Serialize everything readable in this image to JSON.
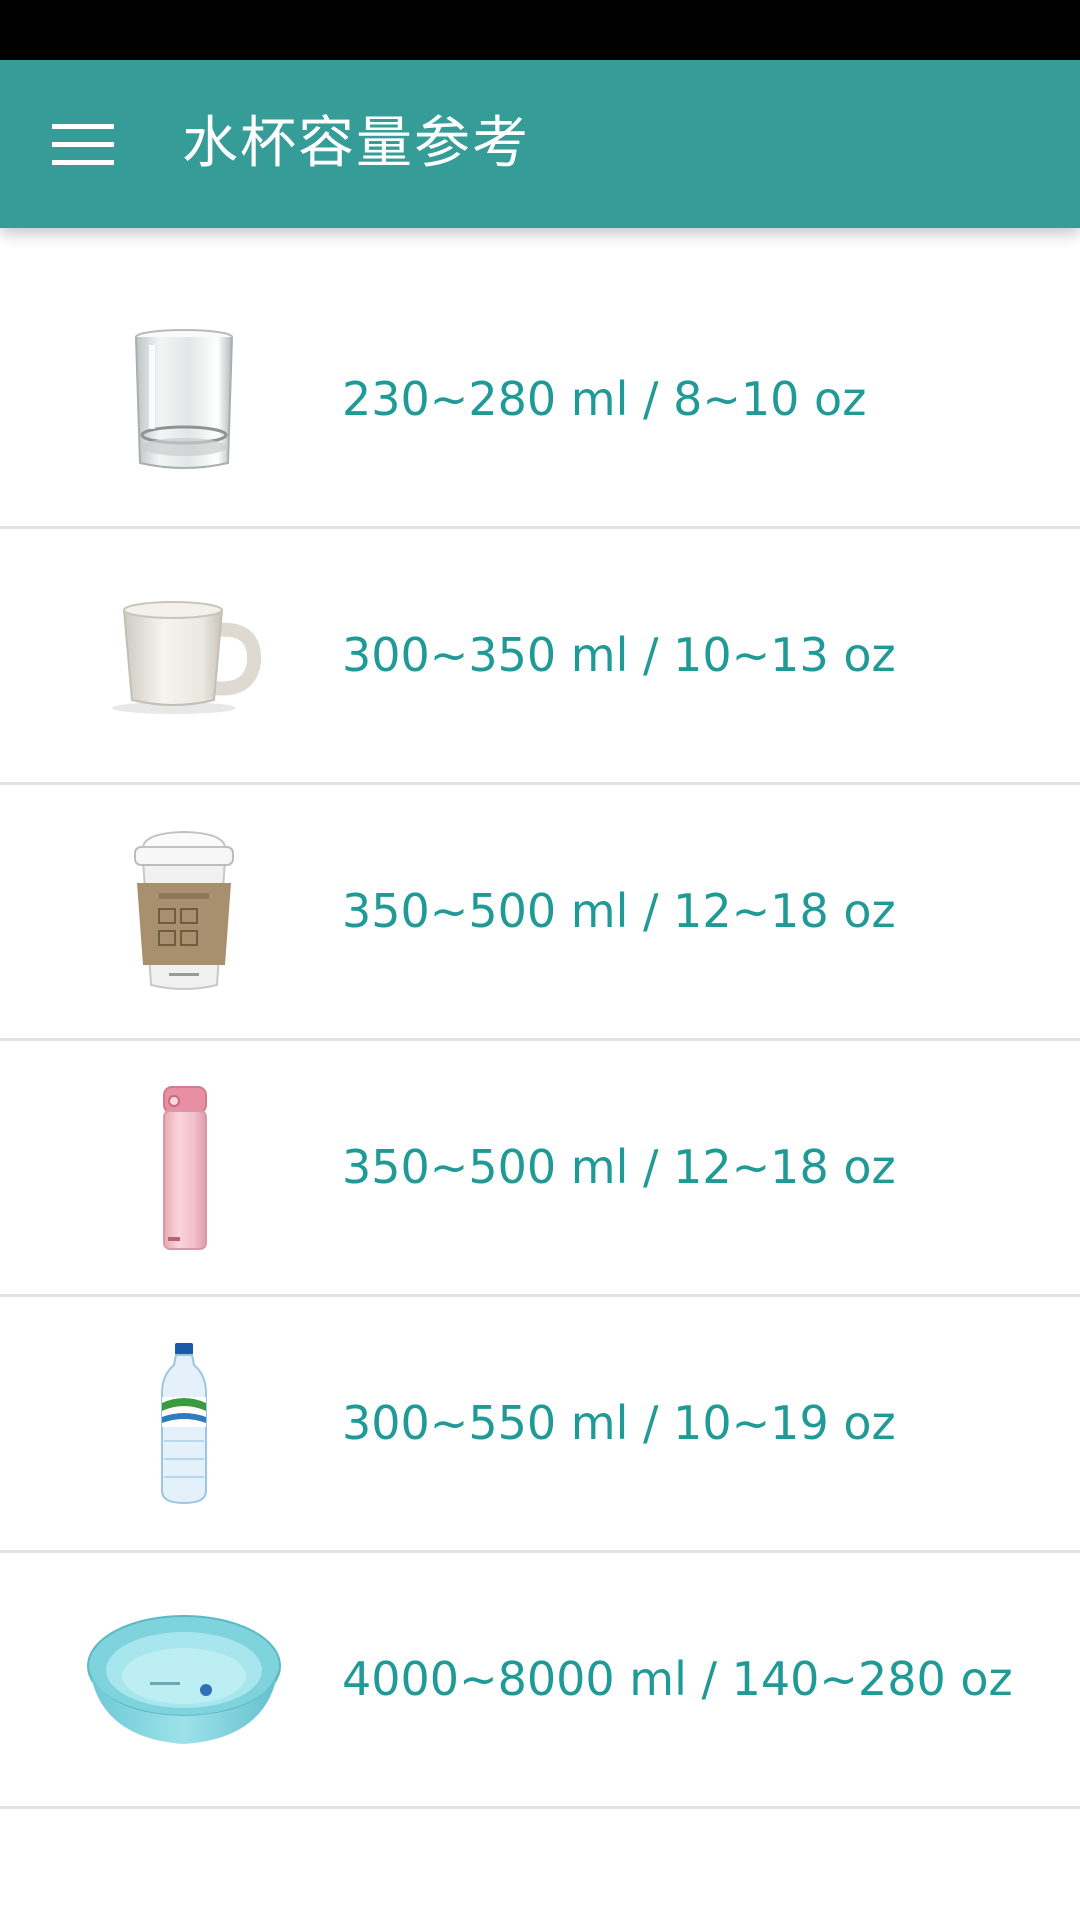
{
  "app_bar": {
    "title": "水杯容量参考",
    "background_color": "#359c98",
    "menu_icon": "hamburger-menu-icon"
  },
  "accent_color": "#1f9a96",
  "items": [
    {
      "image": "glass-tumbler-image",
      "label": "230~280 ml / 8~10 oz"
    },
    {
      "image": "ceramic-mug-image",
      "label": "300~350 ml / 10~13 oz"
    },
    {
      "image": "coffee-cup-image",
      "label": "350~500 ml / 12~18 oz"
    },
    {
      "image": "pink-thermos-image",
      "label": "350~500 ml / 12~18 oz"
    },
    {
      "image": "water-bottle-image",
      "label": "300~550 ml / 10~19 oz"
    },
    {
      "image": "plastic-basin-image",
      "label": "4000~8000 ml / 140~280 oz"
    }
  ]
}
